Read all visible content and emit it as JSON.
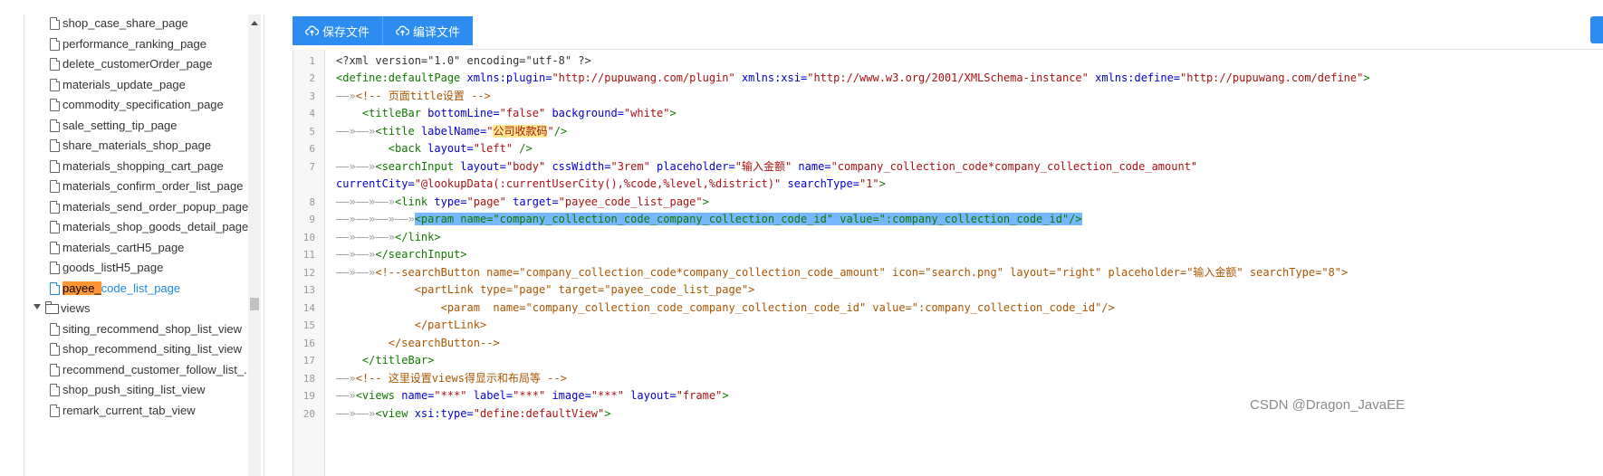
{
  "tree": {
    "files_top": [
      "shop_case_share_page",
      "performance_ranking_page",
      "delete_customerOrder_page",
      "materials_update_page",
      "commodity_specification_page",
      "sale_setting_tip_page",
      "share_materials_shop_page",
      "materials_shopping_cart_page",
      "materials_confirm_order_list_page",
      "materials_send_order_popup_page",
      "materials_shop_goods_detail_page",
      "materials_cartH5_page",
      "goods_listH5_page"
    ],
    "selected": {
      "highlight": "payee_",
      "rest": "code_list_page"
    },
    "folder": "views",
    "files_bottom": [
      "siting_recommend_shop_list_view",
      "shop_recommend_siting_list_view",
      "recommend_customer_follow_list_...",
      "shop_push_siting_list_view",
      "remark_current_tab_view"
    ]
  },
  "toolbar": {
    "save_label": "保存文件",
    "compile_label": "编译文件"
  },
  "code": {
    "line_numbers": [
      "1",
      "2",
      "3",
      "4",
      "5",
      "6",
      "7",
      "",
      "8",
      "9",
      "10",
      "11",
      "12",
      "13",
      "14",
      "15",
      "16",
      "17",
      "18",
      "19",
      "20"
    ],
    "l1": "<?xml version=\"1.0\" encoding=\"utf-8\" ?>",
    "l2": {
      "a": "<define:defaultPage",
      "b": " xmlns:plugin=",
      "c": "\"http://pupuwang.com/plugin\"",
      "d": " xmlns:xsi=",
      "e": "\"http://www.w3.org/2001/XMLSchema-instance\"",
      "f": " xmlns:define=",
      "g": "\"http://pupuwang.com/define\"",
      "h": ">"
    },
    "l3": "<!-- 页面title设置 -->",
    "l4": {
      "tag": "<titleBar",
      "a1": " bottomLine=",
      "v1": "\"false\"",
      "a2": " background=",
      "v2": "\"white\"",
      "end": ">"
    },
    "l5": {
      "tag": "<title",
      "a1": " labelName=",
      "q1": "\"",
      "hl": "公司收款码",
      "q2": "\"",
      "end": "/>"
    },
    "l6": {
      "tag": "<back",
      "a1": " layout=",
      "v1": "\"left\"",
      "end": " />"
    },
    "l7": {
      "tag": "<searchInput",
      "a1": " layout=",
      "v1": "\"body\"",
      "a2": " cssWidth=",
      "v2": "\"3rem\"",
      "a3": " placeholder=",
      "v3": "\"输入金额\"",
      "a4": " name=",
      "v4": "\"company_collection_code*company_collection_code_amount\""
    },
    "l7b": {
      "a1": "currentCity=",
      "v1": "\"@lookupData(:currentUserCity(),%code,%level,%district)\"",
      "a2": " searchType=",
      "v2": "\"1\"",
      "end": ">"
    },
    "l8": {
      "tag": "<link",
      "a1": " type=",
      "v1": "\"page\"",
      "a2": " target=",
      "v2": "\"payee_code_list_page\"",
      "end": ">"
    },
    "l9": "<param name=\"company_collection_code_company_collection_code_id\" value=\":company_collection_code_id\"/>",
    "l10": "</link>",
    "l11": "</searchInput>",
    "l12": "<!--searchButton name=\"company_collection_code*company_collection_code_amount\" icon=\"search.png\" layout=\"right\" placeholder=\"输入金额\" searchType=\"8\">",
    "l13": "partLink type=\"page\" target=\"payee_code_list_page\">",
    "l14": "param  name=\"company_collection_code_company_collection_code_id\" value=\":company_collection_code_id\"/>",
    "l15": "/partLink>",
    "l16": "/searchButton-->",
    "l17": "</titleBar>",
    "l18": "<!-- 这里设置views得显示和布局等 -->",
    "l19": {
      "tag": "<views",
      "a1": " name=",
      "v1": "\"***\"",
      "a2": " label=",
      "v2": "\"***\"",
      "a3": " image=",
      "v3": "\"***\"",
      "a4": " layout=",
      "v4": "\"frame\"",
      "end": ">"
    },
    "l20": {
      "tag": "<view",
      "a1": " xsi:type=",
      "v1": "\"define:defaultView\"",
      "end": ">"
    }
  },
  "watermark": "CSDN @Dragon_JavaEE",
  "colors": {
    "accent": "#2d8cf0",
    "selection": "#74b9ff",
    "search_highlight": "#ff9632"
  }
}
